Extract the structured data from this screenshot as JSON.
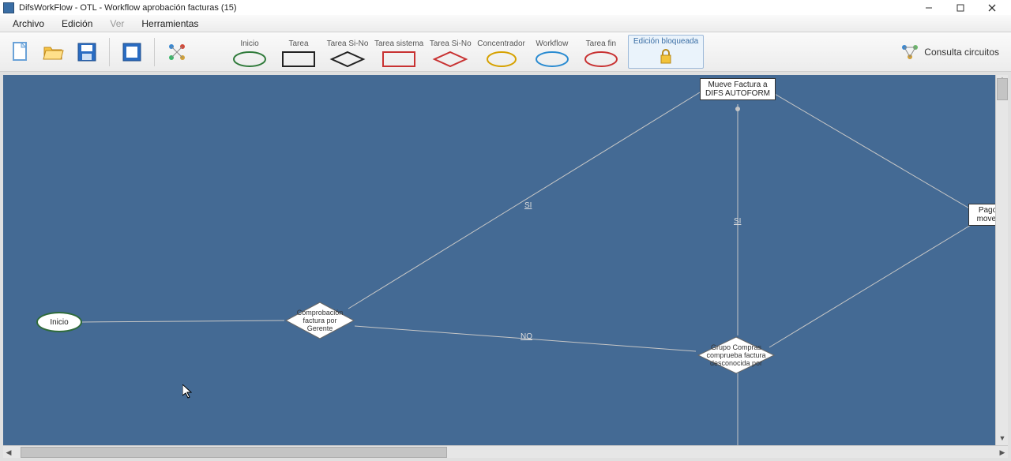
{
  "title": "DifsWorkFlow - OTL - Workflow aprobación facturas (15)",
  "menu": {
    "archivo": "Archivo",
    "edicion": "Edición",
    "ver": "Ver",
    "herramientas": "Herramientas"
  },
  "tools": {
    "inicio": "Inicio",
    "tarea": "Tarea",
    "tarea_sino": "Tarea Si-No",
    "tarea_sistema": "Tarea sistema",
    "tarea_sino2": "Tarea Si-No",
    "concentrador": "Concentrador",
    "workflow": "Workflow",
    "tarea_fin": "Tarea fin",
    "edicion_bloqueada": "Edición bloqueada"
  },
  "consulta_circuitos": "Consulta circuitos",
  "nodes": {
    "inicio": "Inicio",
    "comprobacion": "Comprobación factura por Gerente",
    "mueve": "Mueve Factura a DIFS AUTOFORM",
    "grupo": "Grupo Compras comprueba factura desconocida por",
    "pago": "Pago mover"
  },
  "edges": {
    "si1": "SI",
    "si2": "SI",
    "no": "NO"
  },
  "shape_colors": {
    "inicio_stroke": "#2f7a3a",
    "tarea_stroke": "#222222",
    "sistema_stroke": "#c83232",
    "diamond_stroke": "#c83232",
    "concentrador_stroke": "#d6a100",
    "workflow_stroke": "#2a8bd1",
    "fin_stroke": "#c83232"
  }
}
